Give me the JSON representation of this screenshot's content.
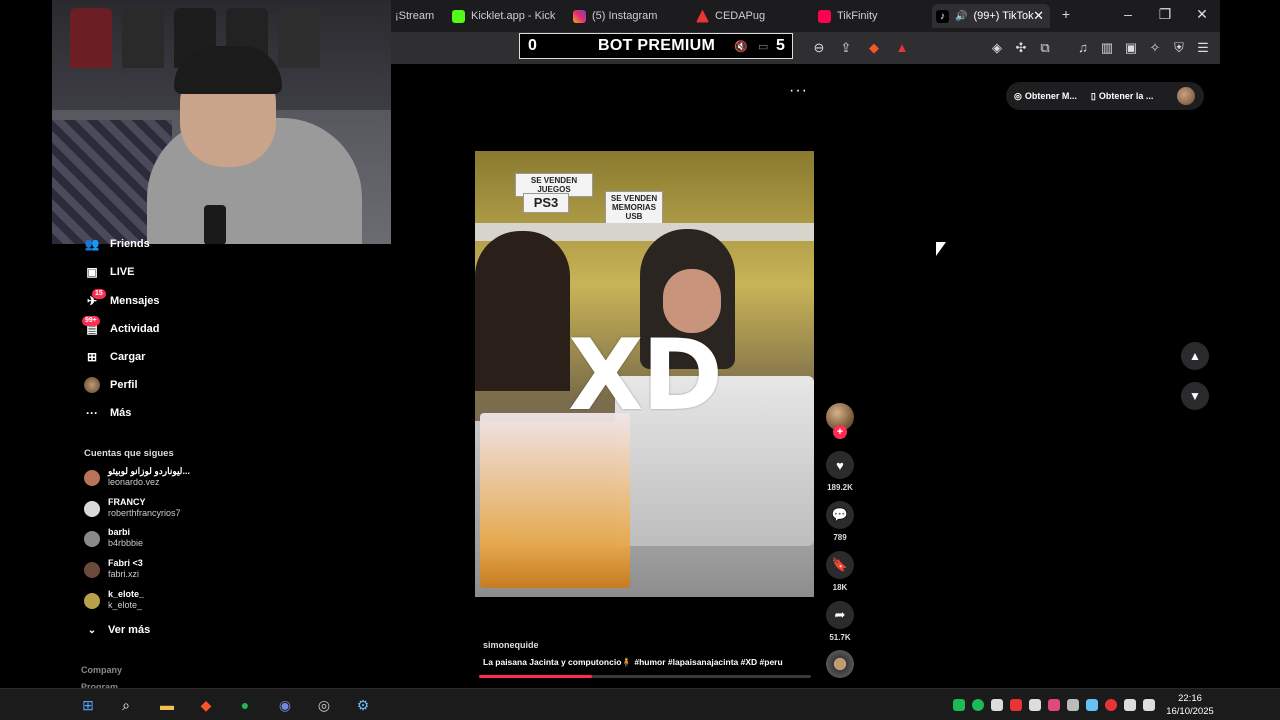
{
  "browser": {
    "tabs": [
      {
        "label": "¡Stream",
        "icon": "stream-icon",
        "color": "#9146ff"
      },
      {
        "label": "Kicklet.app - Kick C",
        "icon": "kicklet-icon",
        "color": "#53fc18"
      },
      {
        "label": "(5) Instagram",
        "icon": "instagram-icon",
        "color": "#e1306c"
      },
      {
        "label": "CEDAPug",
        "icon": "cedapug-icon",
        "color": "#e83434"
      },
      {
        "label": "TikFinity",
        "icon": "tikfinity-icon",
        "color": "#ff0050"
      },
      {
        "label": "(99+) TikTok",
        "icon": "tiktok-icon",
        "color": "#ffffff"
      }
    ],
    "new_tab": "+",
    "minimize": "–",
    "restore": "❐",
    "close": "✕",
    "tab_close": "✕"
  },
  "overlay": {
    "left_count": "0",
    "title": "BOT PREMIUM",
    "right_count": "5"
  },
  "sidebar": {
    "items": [
      {
        "label": "Friends",
        "icon": "friends-icon"
      },
      {
        "label": "LIVE",
        "icon": "live-icon"
      },
      {
        "label": "Mensajes",
        "icon": "messages-icon",
        "badge": "15"
      },
      {
        "label": "Actividad",
        "icon": "activity-icon",
        "badge": "99+"
      },
      {
        "label": "Cargar",
        "icon": "upload-icon"
      },
      {
        "label": "Perfil",
        "icon": "profile-icon"
      },
      {
        "label": "Más",
        "icon": "more-icon"
      }
    ],
    "following_title": "Cuentas que sigues",
    "following": [
      {
        "name": "ليوناردو لوزانو لوبيثو...",
        "user": "leonardo.vez",
        "color": "#b8735a"
      },
      {
        "name": "FRANCY",
        "user": "roberthfrancyrios7",
        "color": "#d9d9d9"
      },
      {
        "name": "barbi",
        "user": "b4rbbbie",
        "color": "#8a8a8a"
      },
      {
        "name": "Fabri <3",
        "user": "fabri.xzi",
        "color": "#6a4a3a"
      },
      {
        "name": "k_elote_",
        "user": "k_elote_",
        "color": "#b9a04a"
      }
    ],
    "see_more": "Ver más",
    "footer": [
      "Company",
      "Program"
    ]
  },
  "top_actions": {
    "get_mobile": "Obtener M...",
    "get_app": "Obtener la ..."
  },
  "video": {
    "overlay_text": "XD",
    "signs": [
      "SE VENDEN JUEGOS",
      "PS3",
      "SE VENDEN MEMORIAS USB"
    ],
    "author": "simonequide",
    "description": "La paisana Jacinta y computoncio🧍 #humor #lapaisanajacinta #XD #peru",
    "progress": 0.34
  },
  "actions": {
    "likes": "189.2K",
    "comments": "789",
    "saves": "18K",
    "shares": "51.7K"
  },
  "taskbar": {
    "time": "22:16",
    "date": "16/10/2025"
  },
  "colors": {
    "accent": "#fe2c55",
    "background": "#000000"
  }
}
